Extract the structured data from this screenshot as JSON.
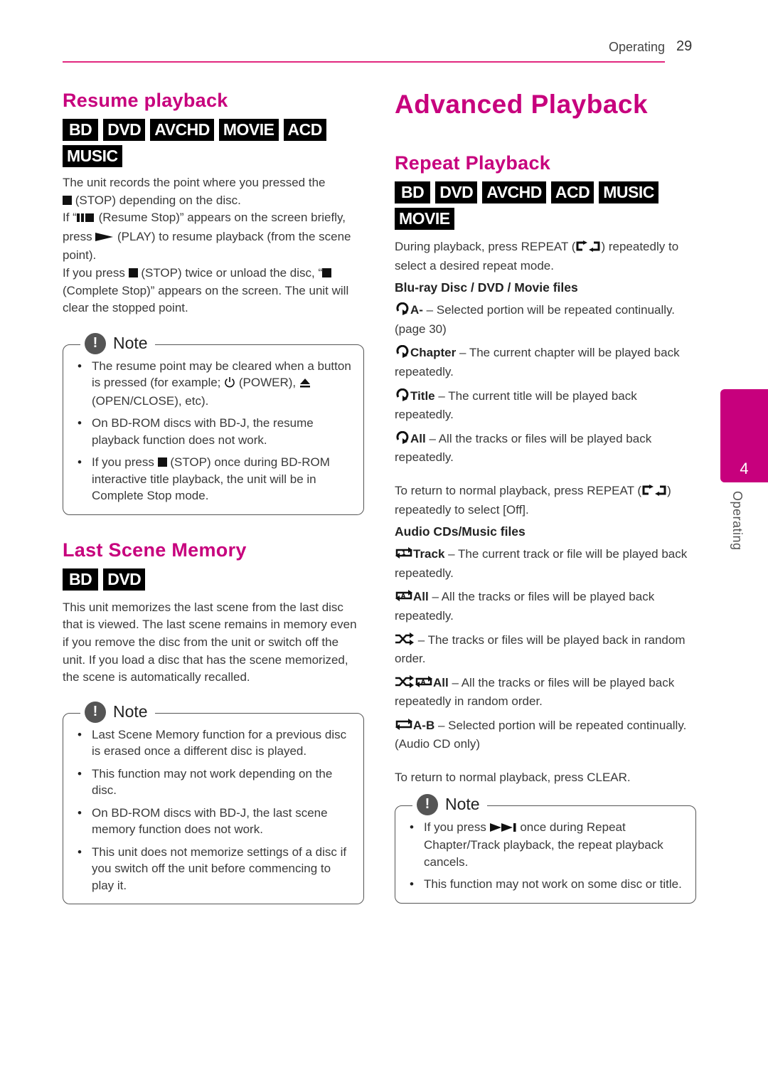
{
  "header": {
    "section": "Operating",
    "page_number": "29"
  },
  "accent_color": "#c7007d",
  "side_tab": {
    "number": "4",
    "label": "Operating"
  },
  "left": {
    "resume": {
      "title": "Resume playback",
      "badges": [
        "BD",
        "DVD",
        "AVCHD",
        "MOVIE",
        "ACD",
        "MUSIC"
      ],
      "p1a": "The unit records the point where you pressed the",
      "p1b": " (STOP) depending on the disc.",
      "p2a": "If “",
      "p2b": " (Resume Stop)” appears on the screen briefly, press ",
      "p2c": " (PLAY) to resume playback (from the scene point).",
      "p3a": "If you press ",
      "p3b": " (STOP) twice or unload the disc, “",
      "p3c": "(Complete Stop)” appears on the screen. The unit will clear the stopped point.",
      "note": {
        "title": "Note",
        "item1a": "The resume point may be cleared when a button is pressed (for example; ",
        "item1b": " (POWER), ",
        "item1c": " (OPEN/CLOSE), etc).",
        "item2": "On BD-ROM discs with BD-J, the resume playback function does not work.",
        "item3a": "If you press ",
        "item3b": " (STOP) once during BD-ROM interactive title playback, the unit will be in Complete Stop mode."
      }
    },
    "last_scene": {
      "title": "Last Scene Memory",
      "badges": [
        "BD",
        "DVD"
      ],
      "body": "This unit memorizes the last scene from the last disc that is viewed. The last scene remains in memory even if you remove the disc from the unit or switch off the unit. If you load a disc that has the scene memorized, the scene is automatically recalled.",
      "note": {
        "title": "Note",
        "items": [
          "Last Scene Memory function for a previous disc is erased once a different disc is played.",
          "This function may not work depending on the disc.",
          "On BD-ROM discs with BD-J, the last scene memory function does not work.",
          "This unit does not memorize settings of a disc if you switch off the unit before commencing to play it."
        ]
      }
    }
  },
  "right": {
    "title": "Advanced Playback",
    "repeat": {
      "title": "Repeat Playback",
      "badges": [
        "BD",
        "DVD",
        "AVCHD",
        "ACD",
        "MUSIC",
        "MOVIE"
      ],
      "intro_a": "During playback, press REPEAT (",
      "intro_b": ") repeatedly to select a desired repeat mode.",
      "bd_heading": "Blu-ray Disc / DVD / Movie files",
      "bd_items": [
        {
          "icon": "repeat-icon",
          "label": "A-",
          "text": " – Selected portion will be repeated continually. (page 30)"
        },
        {
          "icon": "repeat-icon",
          "label": "Chapter",
          "text": " – The current chapter will be played back repeatedly."
        },
        {
          "icon": "repeat-icon",
          "label": "Title",
          "text": " – The current title will be played back repeatedly."
        },
        {
          "icon": "repeat-icon",
          "label": "All",
          "text": " – All the tracks or files will be played back repeatedly."
        }
      ],
      "off_a": "To return to normal playback, press REPEAT (",
      "off_b": ") repeatedly to select [Off].",
      "audio_heading": "Audio CDs/Music files",
      "audio_items": [
        {
          "icon": "repeat-one-icon",
          "label": "Track",
          "text": " – The current track or file will be played back repeatedly."
        },
        {
          "icon": "repeat-all-icon",
          "label": "All",
          "text": " – All the tracks or files will be played back repeatedly."
        },
        {
          "icon": "shuffle-icon",
          "label": "",
          "text": " – The tracks or files will be played back in random order."
        },
        {
          "icon": "shuffle-repeat-all-icon",
          "label": "All",
          "text": " – All the tracks or files will be played back repeatedly in random order."
        },
        {
          "icon": "repeat-ab-icon",
          "label": "A-B",
          "text": " – Selected portion will be repeated continually. (Audio CD only)"
        }
      ],
      "clear_text": "To return to normal playback, press CLEAR.",
      "note": {
        "title": "Note",
        "item1a": "If you press ",
        "item1b": " once during Repeat Chapter/Track playback, the repeat playback cancels.",
        "item2": "This function may not work on some disc or title."
      }
    }
  }
}
